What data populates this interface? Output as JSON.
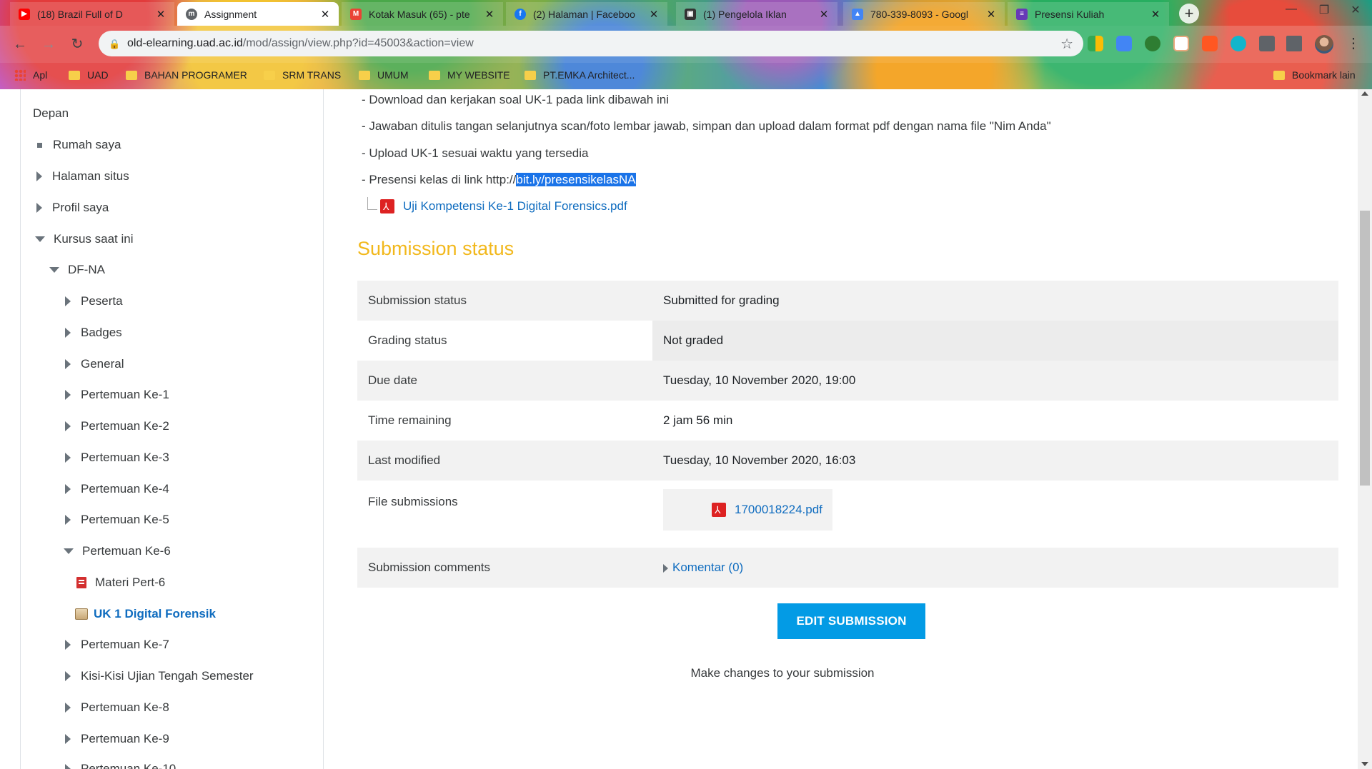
{
  "browser": {
    "tabs": [
      {
        "title": "(18) Brazil Full of D",
        "favicon": "youtube-icon",
        "color": "#ff0000",
        "active": false
      },
      {
        "title": "Assignment",
        "favicon": "moodle-icon",
        "color": "#5f6368",
        "active": true
      },
      {
        "title": "Kotak Masuk (65) - pte",
        "favicon": "gmail-icon",
        "color": "#ea4335",
        "active": false
      },
      {
        "title": "(2) Halaman | Faceboo",
        "favicon": "facebook-icon",
        "color": "#1877f2",
        "active": false
      },
      {
        "title": "(1) Pengelola Iklan",
        "favicon": "ads-manager-icon",
        "color": "#333333",
        "active": false
      },
      {
        "title": "780-339-8093 - Googl",
        "favicon": "google-ads-icon",
        "color": "#4285f4",
        "active": false
      },
      {
        "title": "Presensi Kuliah",
        "favicon": "google-forms-icon",
        "color": "#673ab7",
        "active": false
      }
    ],
    "new_tab": "+",
    "address": {
      "host": "old-elearning.uad.ac.id",
      "path": "/mod/assign/view.php?id=45003&action=view"
    },
    "bookmarks": [
      "Apl",
      "UAD",
      "BAHAN PROGRAMER",
      "SRM TRANS",
      "UMUM",
      "MY WEBSITE",
      "PT.EMKA Architect...",
      "Bookmark lain"
    ]
  },
  "sidebar": {
    "items": [
      {
        "label": "Depan",
        "kind": "none",
        "level": 0
      },
      {
        "label": "Rumah saya",
        "kind": "bullet",
        "level": 1
      },
      {
        "label": "Halaman situs",
        "kind": "collapsed",
        "level": 1
      },
      {
        "label": "Profil saya",
        "kind": "collapsed",
        "level": 1
      },
      {
        "label": "Kursus saat ini",
        "kind": "expanded",
        "level": 1
      },
      {
        "label": "DF-NA",
        "kind": "expanded",
        "level": 2
      },
      {
        "label": "Peserta",
        "kind": "collapsed",
        "level": 3
      },
      {
        "label": "Badges",
        "kind": "collapsed",
        "level": 3
      },
      {
        "label": "General",
        "kind": "collapsed",
        "level": 3
      },
      {
        "label": "Pertemuan Ke-1",
        "kind": "collapsed",
        "level": 3
      },
      {
        "label": "Pertemuan Ke-2",
        "kind": "collapsed",
        "level": 3
      },
      {
        "label": "Pertemuan Ke-3",
        "kind": "collapsed",
        "level": 3
      },
      {
        "label": "Pertemuan Ke-4",
        "kind": "collapsed",
        "level": 3
      },
      {
        "label": "Pertemuan Ke-5",
        "kind": "collapsed",
        "level": 3
      },
      {
        "label": "Pertemuan Ke-6",
        "kind": "expanded",
        "level": 3
      },
      {
        "label": "Materi Pert-6",
        "kind": "pdf",
        "level": 4
      },
      {
        "label": "UK 1 Digital Forensik",
        "kind": "assign",
        "level": 4,
        "current": true
      },
      {
        "label": "Pertemuan Ke-7",
        "kind": "collapsed",
        "level": 3
      },
      {
        "label": "Kisi-Kisi Ujian Tengah Semester",
        "kind": "collapsed",
        "level": 3
      },
      {
        "label": "Pertemuan Ke-8",
        "kind": "collapsed",
        "level": 3
      },
      {
        "label": "Pertemuan Ke-9",
        "kind": "collapsed",
        "level": 3
      },
      {
        "label": "Pertemuan Ke-10",
        "kind": "collapsed",
        "level": 3
      }
    ]
  },
  "instructions": {
    "line1": "- Download dan kerjakan soal UK-1 pada link dibawah ini",
    "line2": "- Jawaban ditulis tangan selanjutnya scan/foto lembar jawab, simpan dan upload dalam format pdf dengan nama file \"Nim Anda\"",
    "line3": "- Upload UK-1 sesuai waktu yang tersedia",
    "line4_prefix": "- Presensi kelas di link http://",
    "line4_link": "bit.ly/presensikelasNA",
    "attachment": "Uji Kompetensi Ke-1 Digital Forensics.pdf"
  },
  "submission": {
    "heading": "Submission status",
    "rows": {
      "status": {
        "label": "Submission status",
        "value": "Submitted for grading"
      },
      "grading": {
        "label": "Grading status",
        "value": "Not graded"
      },
      "due": {
        "label": "Due date",
        "value": "Tuesday, 10 November 2020, 19:00"
      },
      "remaining": {
        "label": "Time remaining",
        "value": "2 jam 56 min"
      },
      "modified": {
        "label": "Last modified",
        "value": "Tuesday, 10 November 2020, 16:03"
      },
      "files": {
        "label": "File submissions",
        "value": "1700018224.pdf"
      },
      "comments": {
        "label": "Submission comments",
        "value": "Komentar (0)"
      }
    },
    "edit_button": "EDIT SUBMISSION",
    "edit_hint": "Make changes to your submission"
  },
  "colors": {
    "accent": "#f2b81c",
    "link": "#0f6cbf",
    "button": "#039be5"
  }
}
